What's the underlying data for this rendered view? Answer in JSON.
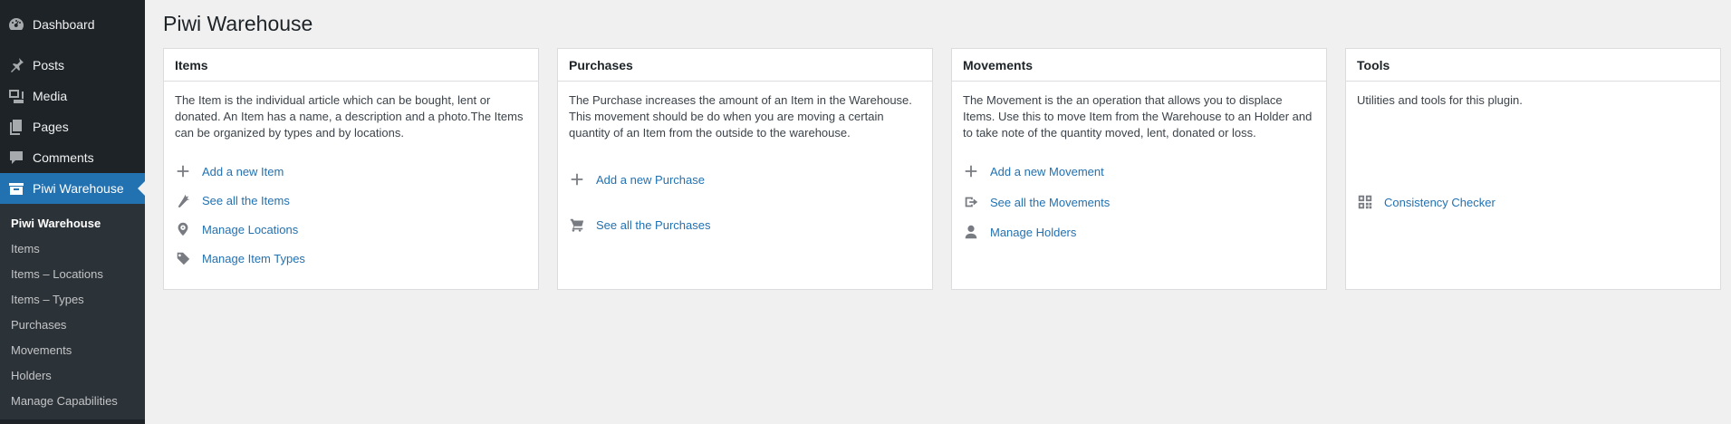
{
  "sidebar": {
    "top_items": [
      {
        "label": "Dashboard",
        "icon": "dashboard-icon"
      },
      {
        "label": "Posts",
        "icon": "pin-icon"
      },
      {
        "label": "Media",
        "icon": "media-icon"
      },
      {
        "label": "Pages",
        "icon": "pages-icon"
      },
      {
        "label": "Comments",
        "icon": "comment-icon"
      },
      {
        "label": "Piwi Warehouse",
        "icon": "archive-icon"
      }
    ],
    "submenu": [
      "Piwi Warehouse",
      "Items",
      "Items – Locations",
      "Items – Types",
      "Purchases",
      "Movements",
      "Holders",
      "Manage Capabilities"
    ]
  },
  "page": {
    "title": "Piwi Warehouse"
  },
  "cards": {
    "items": {
      "title": "Items",
      "description": "The Item is the individual article which can be bought, lent or donated. An Item has a name, a description and a photo.The Items can be organized by types and by locations.",
      "links": [
        "Add a new Item",
        "See all the Items",
        "Manage Locations",
        "Manage Item Types"
      ]
    },
    "purchases": {
      "title": "Purchases",
      "description": "The Purchase increases the amount of an Item in the Warehouse. This movement should be do when you are moving a certain quantity of an Item from the outside to the warehouse.",
      "links": [
        "Add a new Purchase",
        "See all the Purchases"
      ]
    },
    "movements": {
      "title": "Movements",
      "description": "The Movement is the an operation that allows you to displace Items. Use this to move Item from the Warehouse to an Holder and to take note of the quantity moved, lent, donated or loss.",
      "links": [
        "Add a new Movement",
        "See all the Movements",
        "Manage Holders"
      ]
    },
    "tools": {
      "title": "Tools",
      "description": "Utilities and tools for this plugin.",
      "links": [
        "Consistency Checker"
      ]
    }
  },
  "colors": {
    "sidebar_bg": "#1d2327",
    "submenu_bg": "#2c3338",
    "accent": "#2271b1",
    "page_bg": "#f0f0f1"
  }
}
